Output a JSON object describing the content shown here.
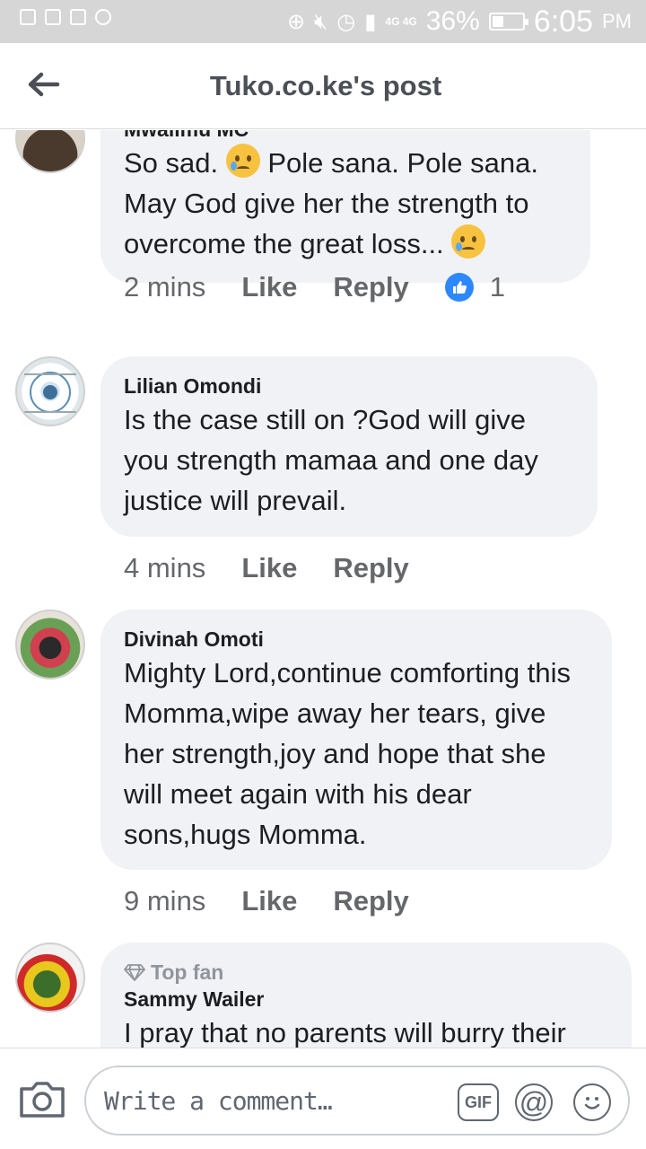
{
  "status_bar": {
    "network": "4G 4G",
    "battery": "36%",
    "battery_level": 0.36,
    "time": "6:05",
    "ampm": "PM"
  },
  "header": {
    "title": "Tuko.co.ke's post",
    "back_icon": "back-arrow-icon"
  },
  "comments": [
    {
      "author": "Mwalimu MC",
      "text_parts": [
        "So sad. ",
        " Pole sana. Pole sana. May God give her the strength to overcome the great loss... "
      ],
      "time": "2 mins",
      "like": "Like",
      "reply": "Reply",
      "reaction_count": "1"
    },
    {
      "author": "Lilian Omondi",
      "text": "Is the case still on ?God will give you strength mamaa and one day justice will prevail.",
      "time": "4 mins",
      "like": "Like",
      "reply": "Reply"
    },
    {
      "author": "Divinah Omoti",
      "text": "Mighty Lord,continue comforting this Momma,wipe away her tears, give her strength,joy and hope that she will meet again with his dear sons,hugs Momma.",
      "time": "9 mins",
      "like": "Like",
      "reply": "Reply"
    },
    {
      "badge": "Top fan",
      "author": "Sammy Wailer",
      "text": "I pray that no parents will burry their"
    }
  ],
  "composer": {
    "placeholder": "Write a comment…",
    "gif_label": "GIF",
    "at_label": "@"
  },
  "colors": {
    "bubble": "#f0f2f5",
    "like_blue": "#2d88ff",
    "status_bar": "#d6d6d6"
  }
}
